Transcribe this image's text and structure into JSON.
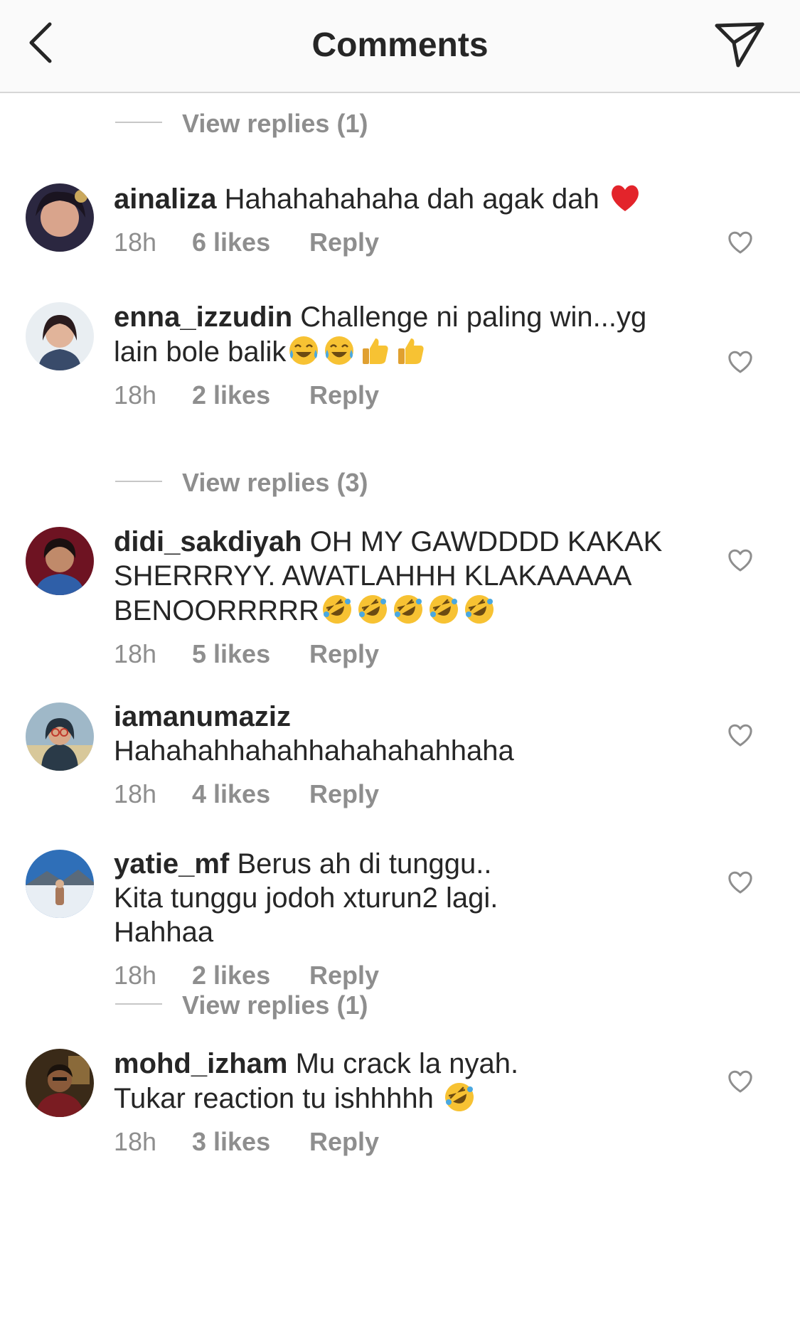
{
  "header": {
    "title": "Comments",
    "back_icon": "chevron-left-icon",
    "send_icon": "paper-plane-icon"
  },
  "view_replies": [
    "View replies (1)",
    "View replies (3)",
    "View replies (1)"
  ],
  "comments": [
    {
      "username": "ainaliza",
      "text": "Hahahahahaha dah agak dah",
      "emojis": [
        "❤️"
      ],
      "time": "18h",
      "likes": "6 likes",
      "reply": "Reply"
    },
    {
      "username": "enna_izzudin",
      "text": "Challenge ni paling win...yg lain bole balik",
      "emojis": [
        "😂",
        "😂",
        "👍",
        "👍"
      ],
      "time": "18h",
      "likes": "2 likes",
      "reply": "Reply"
    },
    {
      "username": "didi_sakdiyah",
      "text": "OH MY GAWDDDD KAKAK SHERRRYY. AWATLAHHH KLAKAAAAA BENOORRRRR",
      "emojis": [
        "🤣",
        "🤣",
        "🤣",
        "🤣",
        "🤣"
      ],
      "time": "18h",
      "likes": "5 likes",
      "reply": "Reply"
    },
    {
      "username": "iamanumaziz",
      "text": "Hahahahhahahhahahahahhaha",
      "emojis": [],
      "time": "18h",
      "likes": "4 likes",
      "reply": "Reply"
    },
    {
      "username": "yatie_mf",
      "text": "Berus ah di tunggu.. Kita tunggu jodoh xturun2 lagi. Hahhaa",
      "emojis": [],
      "time": "18h",
      "likes": "2 likes",
      "reply": "Reply"
    },
    {
      "username": "mohd_izham",
      "text": "Mu crack la nyah. Tukar reaction tu ishhhhh",
      "emojis": [
        "🤣"
      ],
      "time": "18h",
      "likes": "3 likes",
      "reply": "Reply"
    }
  ],
  "colors": {
    "text": "#262626",
    "secondary": "#8e8e8e",
    "divider": "#c7c7c7",
    "header_bg": "#fafafa",
    "heart_red": "#e3242b",
    "emoji_yellow": "#f7c233"
  }
}
